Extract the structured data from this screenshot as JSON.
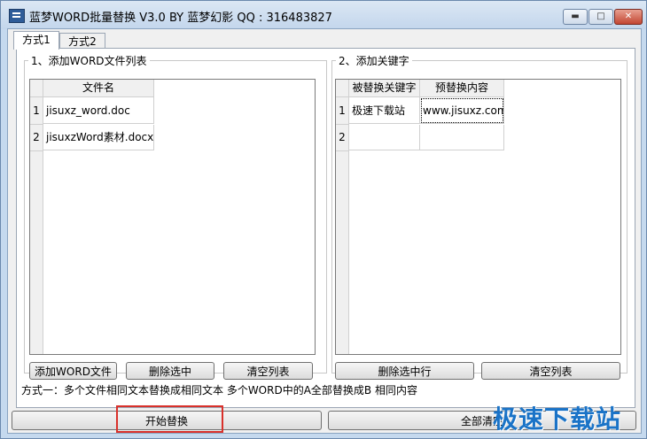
{
  "window": {
    "title": "蓝梦WORD批量替换 V3.0 BY 蓝梦幻影 QQ : 316483827",
    "controls": {
      "minimize": "▬",
      "maximize": "□",
      "close": "✕"
    }
  },
  "tabs": [
    {
      "label": "方式1",
      "active": true
    },
    {
      "label": "方式2",
      "active": false
    }
  ],
  "left_panel": {
    "legend": "1、添加WORD文件列表",
    "column_header": "文件名",
    "rows": [
      {
        "num": "1",
        "file": "jisuxz_word.doc"
      },
      {
        "num": "2",
        "file": "jisuxzWord素材.docx"
      }
    ],
    "buttons": {
      "add": "添加WORD文件",
      "delete": "删除选中",
      "clear": "清空列表"
    }
  },
  "right_panel": {
    "legend": "2、添加关键字",
    "columns": [
      "被替换关键字",
      "预替换内容"
    ],
    "rows": [
      {
        "num": "1",
        "find": "极速下载站",
        "replace": "www.jisuxz.com"
      },
      {
        "num": "2",
        "find": "",
        "replace": ""
      }
    ],
    "buttons": {
      "delete_row": "删除选中行",
      "clear": "清空列表"
    }
  },
  "hint": "方式一：多个文件相同文本替换成相同文本   多个WORD中的A全部替换成B 相同内容",
  "bottom": {
    "start": "开始替换",
    "clear_all": "全部清空"
  },
  "watermark": "极速下载站"
}
